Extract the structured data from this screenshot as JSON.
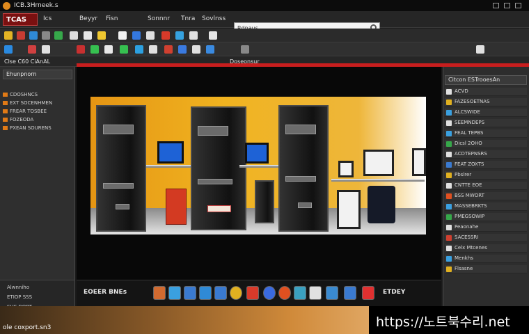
{
  "window": {
    "title": "ICB.3Hrneek.s"
  },
  "menubar": {
    "logo": "TCAS",
    "items": [
      "Ics",
      "Beyyr",
      "Fisn",
      "Sonnnr",
      "Tnra",
      "Sovlnss"
    ],
    "search": {
      "value": "Rdnaus"
    }
  },
  "toolbar3": {
    "left_label": "Clse C60 CiAnAL",
    "center_label": "Doseonsur"
  },
  "left_panel": {
    "header": "Ehunpnorn",
    "items": [
      "CDOSHNCS",
      "EXT SOCENHMEN",
      "FREAR TOSBEE",
      "FOZEODA",
      "PXEAN SOURENS"
    ],
    "bottom_items": [
      "Alwnniho",
      "ETIOP SSS",
      "SHE DORT"
    ]
  },
  "dock": {
    "left_label": "EOEER BNEs",
    "right_label": "ETDEY"
  },
  "right_panel": {
    "header": "Citcon ESTrooesAn",
    "items": [
      "ACVD",
      "FAZESOETNAS",
      "ALCSWIDE",
      "SEEMNDEPS",
      "FEAL TEPBS",
      "Dicsl 2OHO",
      "ACDTEPNSRS",
      "FEAT ZOXTS",
      "Pbslrer",
      "CNTTE EOE",
      "BSS MWORT",
      "MASSEBRKTS",
      "PMEGSOWIP",
      "Peaonahe",
      "SACESSRI",
      "Celx Mtcenes",
      "Menkhs",
      "Flsasne"
    ]
  },
  "bottom": {
    "status": "ole coxport.sn3"
  },
  "watermark": "https://노트북수리.net"
}
